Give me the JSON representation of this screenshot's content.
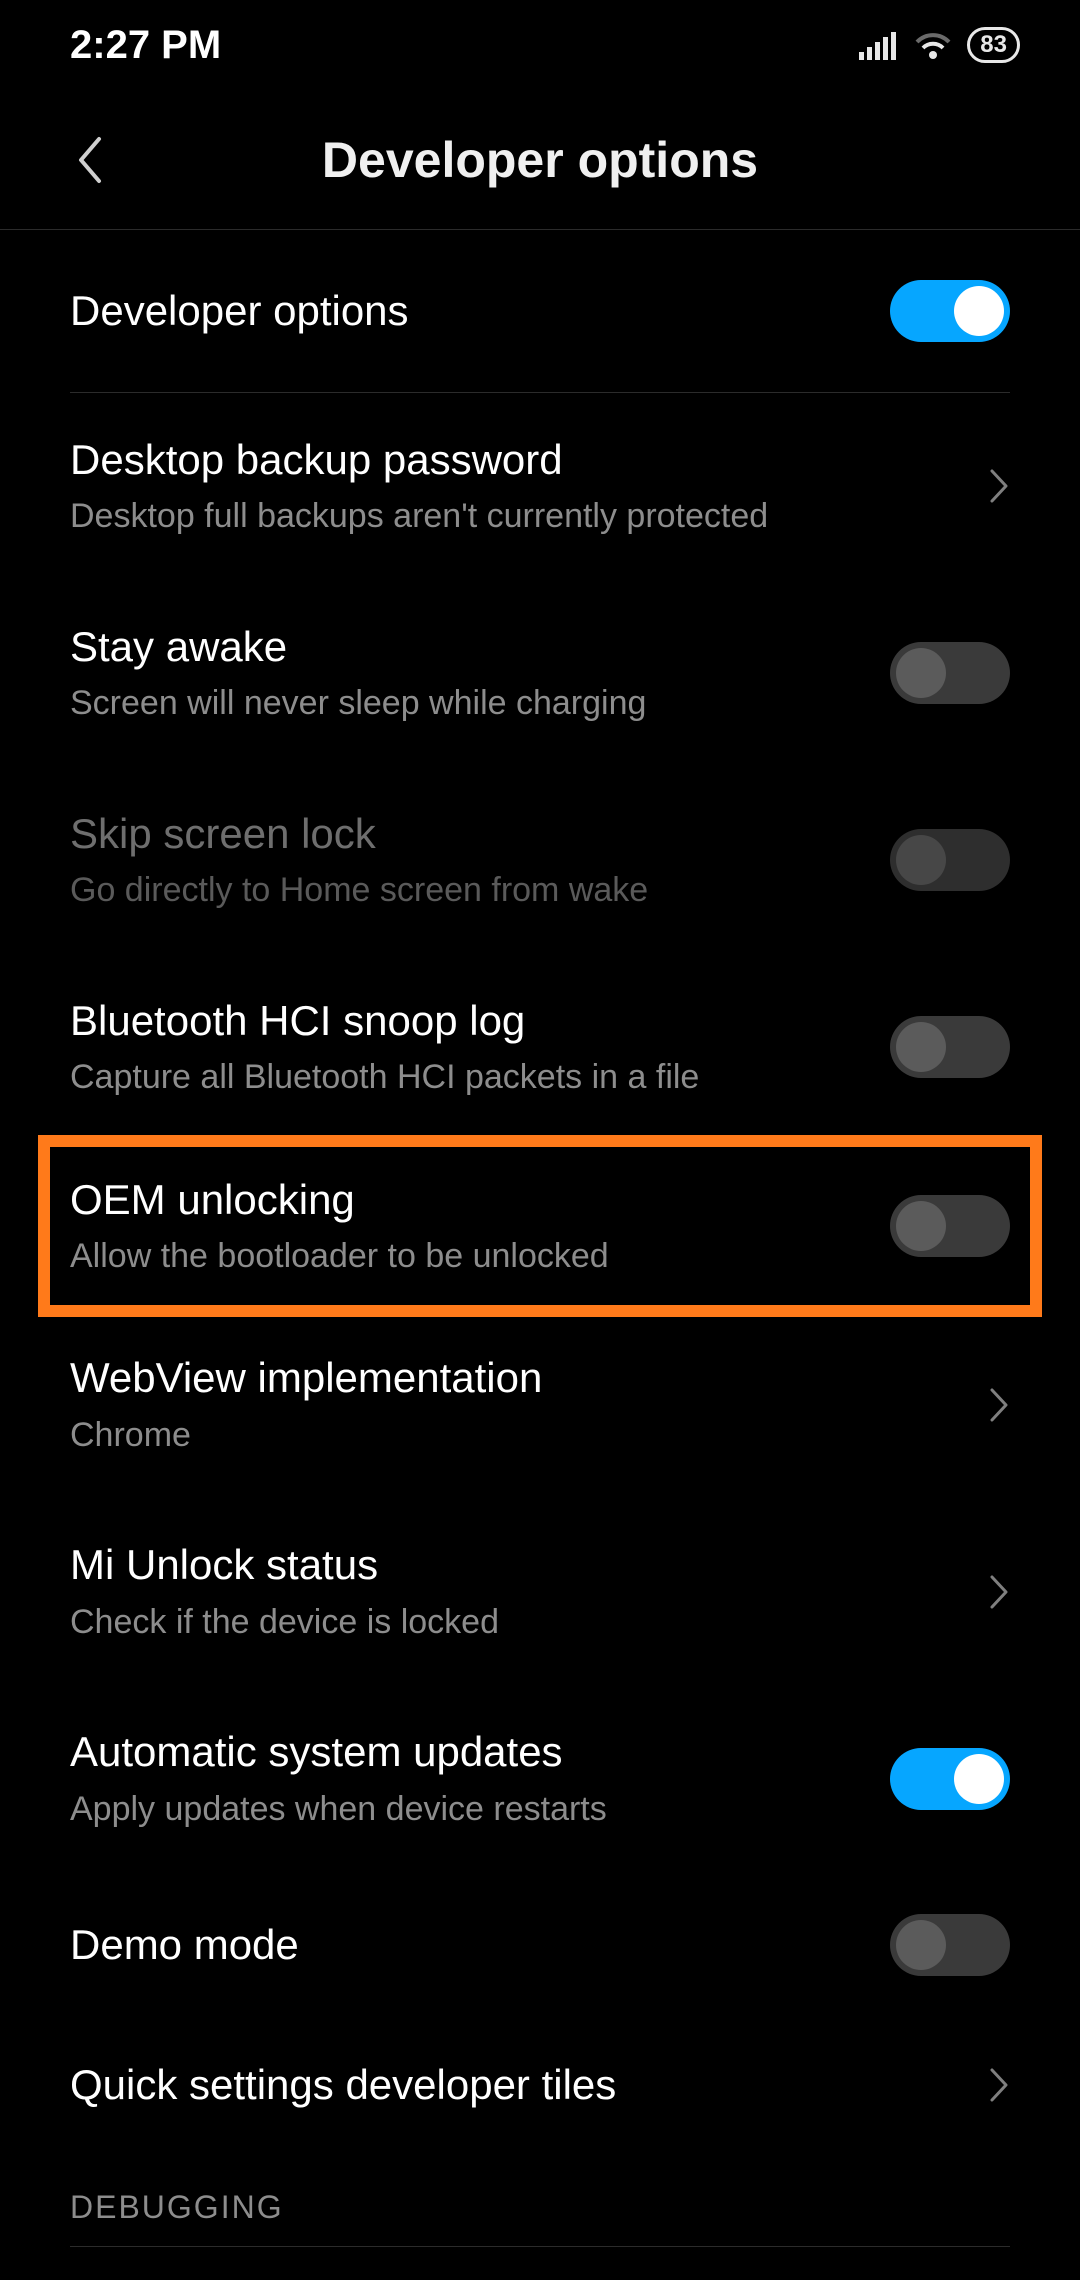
{
  "status": {
    "time": "2:27 PM",
    "battery": "83"
  },
  "header": {
    "title": "Developer options"
  },
  "rows": {
    "master": {
      "title": "Developer options"
    },
    "desktop": {
      "title": "Desktop backup password",
      "sub": "Desktop full backups aren't currently protected"
    },
    "stayawake": {
      "title": "Stay awake",
      "sub": "Screen will never sleep while charging"
    },
    "skiplock": {
      "title": "Skip screen lock",
      "sub": "Go directly to Home screen from wake"
    },
    "hci": {
      "title": "Bluetooth HCI snoop log",
      "sub": "Capture all Bluetooth HCI packets in a file"
    },
    "oem": {
      "title": "OEM unlocking",
      "sub": "Allow the bootloader to be unlocked"
    },
    "webview": {
      "title": "WebView implementation",
      "sub": "Chrome"
    },
    "miunlock": {
      "title": "Mi Unlock status",
      "sub": "Check if the device is locked"
    },
    "autoupdate": {
      "title": "Automatic system updates",
      "sub": "Apply updates when device restarts"
    },
    "demo": {
      "title": "Demo mode"
    },
    "qstiles": {
      "title": "Quick settings developer tiles"
    }
  },
  "sections": {
    "debugging": "DEBUGGING"
  },
  "toggle_state": {
    "master": true,
    "stayawake": false,
    "skiplock": false,
    "hci": false,
    "oem": false,
    "autoupdate": true,
    "demo": false
  }
}
